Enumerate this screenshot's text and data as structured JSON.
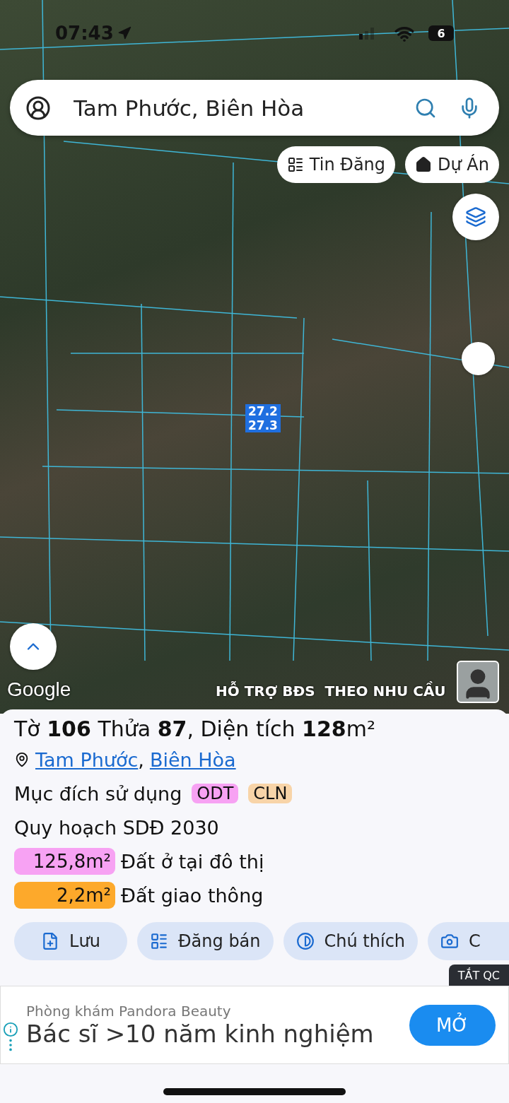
{
  "status_bar": {
    "time": "07:43",
    "battery": "6"
  },
  "search": {
    "value": "Tam Phước, Biên Hòa"
  },
  "map_chips": [
    {
      "label": "Tin Đăng",
      "kind": "listings"
    },
    {
      "label": "Dự Án",
      "kind": "projects"
    }
  ],
  "map": {
    "parcel_labels": [
      "27.2",
      "27.3"
    ],
    "attribution": "Google",
    "promo_text": "HỖ TRỢ BĐS  THEO NHU CẦU"
  },
  "parcel": {
    "title": "Tờ **106** Thửa **87**, Diện tích **128**m²",
    "location": [
      "Tam Phước",
      "Biên Hòa"
    ],
    "location_separator": ",",
    "purpose_label": "Mục đích sử dụng",
    "purpose_tags": [
      {
        "code": "ODT",
        "color": "#f7a2f3"
      },
      {
        "code": "CLN",
        "color": "#f8d4a8"
      }
    ],
    "plan_title": "Quy hoạch SDĐ 2030",
    "plan_areas": [
      {
        "area": "125,8m²",
        "label": "Đất ở tại đô thị",
        "color": "#f7a2f3"
      },
      {
        "area": "2,2m²",
        "label": "Đất giao thông",
        "color": "#fda92b"
      }
    ]
  },
  "actions": [
    {
      "label": "Lưu",
      "kind": "save"
    },
    {
      "label": "Đăng bán",
      "kind": "sell"
    },
    {
      "label": "Chú thích",
      "kind": "legend"
    },
    {
      "label": "C",
      "kind": "photo"
    }
  ],
  "ad": {
    "close_label": "TẮT QC",
    "advertiser": "Phòng khám Pandora Beauty",
    "headline": "Bác sĩ >10 năm kinh nghiệm",
    "cta": "MỞ"
  }
}
